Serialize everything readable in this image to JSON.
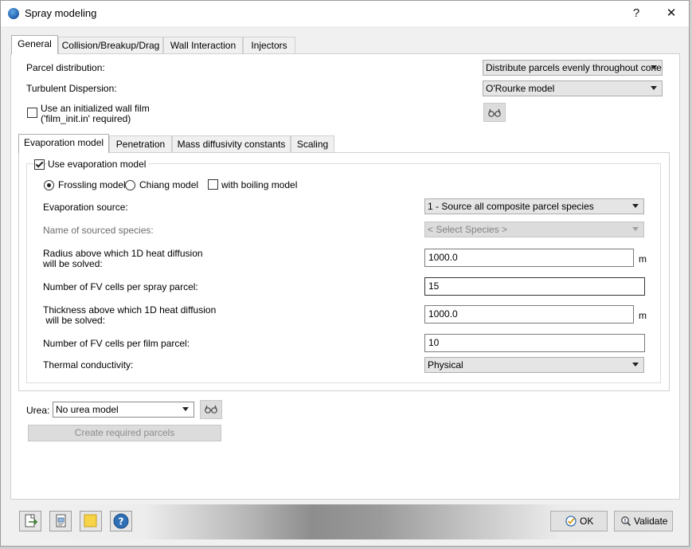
{
  "window": {
    "title": "Spray modeling",
    "help_label": "?",
    "close_label": "✕"
  },
  "main_tabs": [
    "General",
    "Collision/Breakup/Drag",
    "Wall Interaction",
    "Injectors"
  ],
  "general": {
    "parcel_distribution": {
      "label": "Parcel distribution:",
      "value": "Distribute parcels evenly throughout cone"
    },
    "turbulent_dispersion": {
      "label": "Turbulent Dispersion:",
      "value": "O'Rourke model"
    },
    "wall_film": {
      "label_line1": "Use an initialized wall film",
      "label_line2": "('film_init.in' required)",
      "checked": false
    }
  },
  "sub_tabs": [
    "Evaporation model",
    "Penetration",
    "Mass diffusivity constants",
    "Scaling"
  ],
  "evaporation": {
    "use_label": "Use evaporation model",
    "use_checked": true,
    "frossling_label": "Frossling model",
    "chiang_label": "Chiang model",
    "boiling_label": "with boiling model",
    "source": {
      "label": "Evaporation source:",
      "value": "1 - Source all composite parcel species"
    },
    "sourced_species": {
      "label": "Name of sourced species:",
      "value": "< Select Species >"
    },
    "radius": {
      "label_line1": "Radius above which 1D heat diffusion",
      "label_line2": "will be solved:",
      "value": "1000.0",
      "unit": "m"
    },
    "fv_cells_spray": {
      "label": "Number of FV cells per spray parcel:",
      "value": "15"
    },
    "thickness": {
      "label_line1": "Thickness above which 1D heat diffusion",
      "label_line2": " will be solved:",
      "value": "1000.0",
      "unit": "m"
    },
    "fv_cells_film": {
      "label": "Number of FV cells per film parcel:",
      "value": "10"
    },
    "thermal_conductivity": {
      "label": "Thermal conductivity:",
      "value": "Physical"
    }
  },
  "urea": {
    "label": "Urea:",
    "value": "No urea model"
  },
  "create_parcels_label": "Create required parcels",
  "footer": {
    "ok_label": "OK",
    "validate_label": "Validate"
  },
  "icons": [
    "export-icon",
    "document-icon",
    "notes-icon",
    "help-icon",
    "glasses-icon",
    "check-icon",
    "magnifier-icon"
  ]
}
